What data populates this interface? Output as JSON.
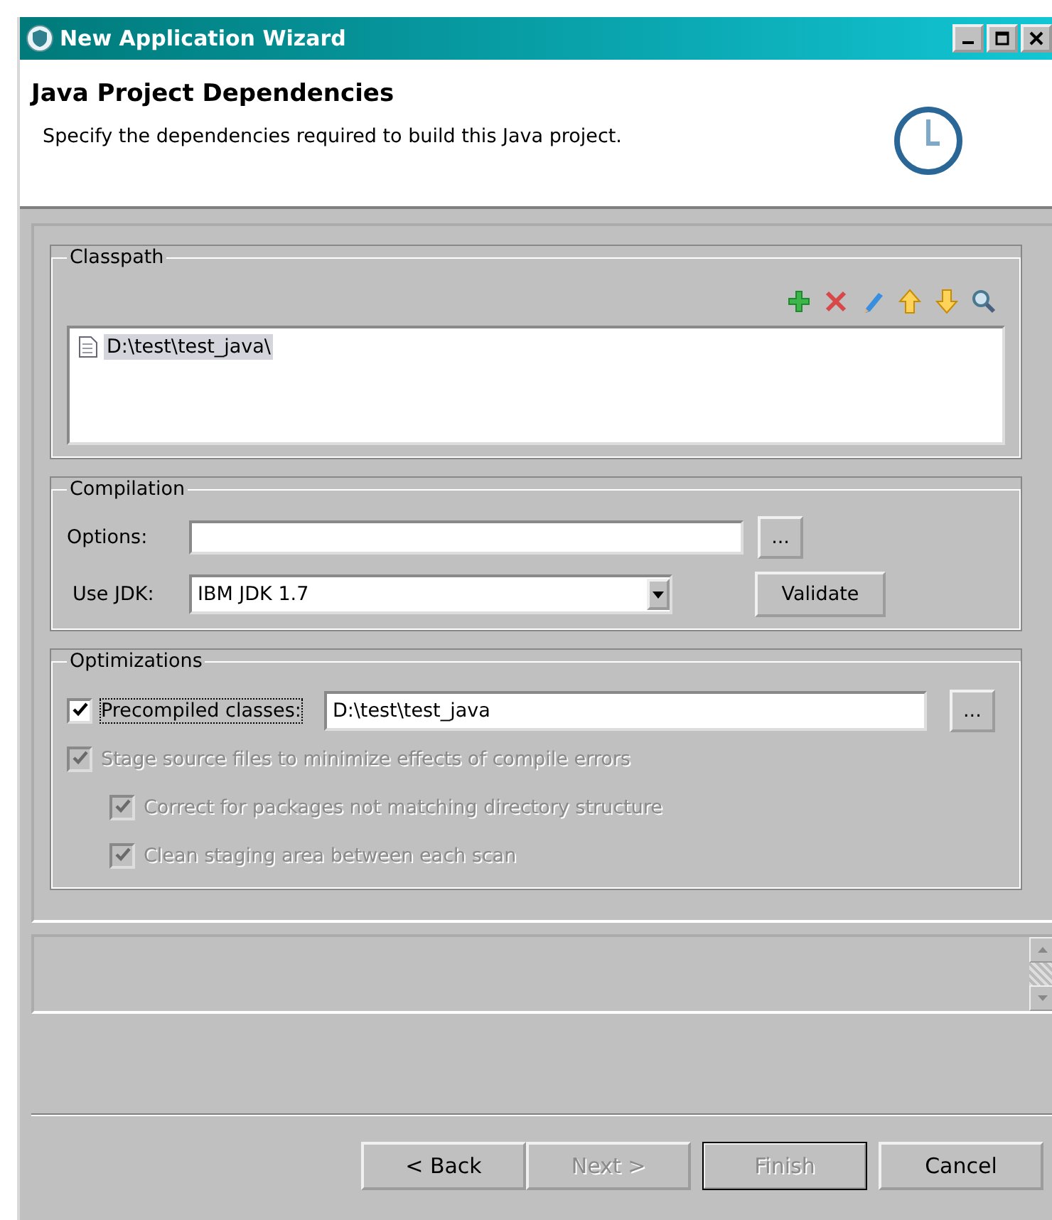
{
  "window": {
    "title": "New Application Wizard"
  },
  "header": {
    "title": "Java Project Dependencies",
    "description": "Specify the dependencies required to build this Java project."
  },
  "classpath": {
    "label": "Classpath",
    "entries": [
      {
        "path": "D:\\test\\test_java\\",
        "selected": true
      }
    ]
  },
  "compilation": {
    "label": "Compilation",
    "options_label": "Options:",
    "browse": "...",
    "jdk_label": "Use JDK:",
    "jdk_value": "IBM JDK 1.7",
    "validate": "Validate"
  },
  "optimizations": {
    "label": "Optimizations",
    "browse": "...",
    "path_value": "D:\\test\\test_java",
    "options": [
      {
        "label": "Precompiled classes:",
        "checked": true,
        "disabled": false,
        "indented": false,
        "focused": true
      },
      {
        "label": "Stage source files to minimize effects of compile errors",
        "checked": true,
        "disabled": true,
        "indented": false,
        "focused": false
      },
      {
        "label": "Correct for packages not matching directory structure",
        "checked": true,
        "disabled": true,
        "indented": true,
        "focused": false
      },
      {
        "label": "Clean staging area between each scan",
        "checked": true,
        "disabled": true,
        "indented": true,
        "focused": false
      }
    ]
  },
  "buttons": [
    {
      "label": "< Back",
      "disabled": false,
      "default": false
    },
    {
      "label": "Next >",
      "disabled": true,
      "default": false
    },
    {
      "label": "Finish",
      "disabled": true,
      "default": true
    },
    {
      "label": "Cancel",
      "disabled": false,
      "default": false
    }
  ]
}
